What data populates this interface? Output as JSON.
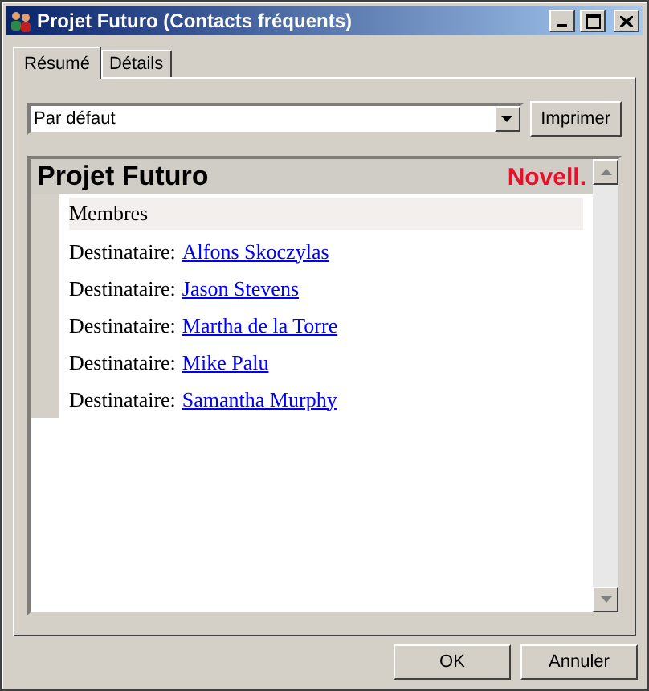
{
  "window": {
    "title": "Projet Futuro (Contacts fréquents)"
  },
  "tabs": [
    {
      "label": "Résumé",
      "selected": true
    },
    {
      "label": "Détails",
      "selected": false
    }
  ],
  "view_select": {
    "value": "Par défaut"
  },
  "print_button": "Imprimer",
  "document": {
    "title": "Projet Futuro",
    "logo": "Novell.",
    "section": "Membres",
    "members": [
      {
        "label": "Destinataire:",
        "name": "Alfons Skoczylas"
      },
      {
        "label": "Destinataire:",
        "name": "Jason Stevens"
      },
      {
        "label": "Destinataire:",
        "name": "Martha de la Torre"
      },
      {
        "label": "Destinataire:",
        "name": "Mike Palu"
      },
      {
        "label": "Destinataire:",
        "name": "Samantha Murphy"
      }
    ]
  },
  "buttons": [
    "OK",
    "Annuler"
  ]
}
